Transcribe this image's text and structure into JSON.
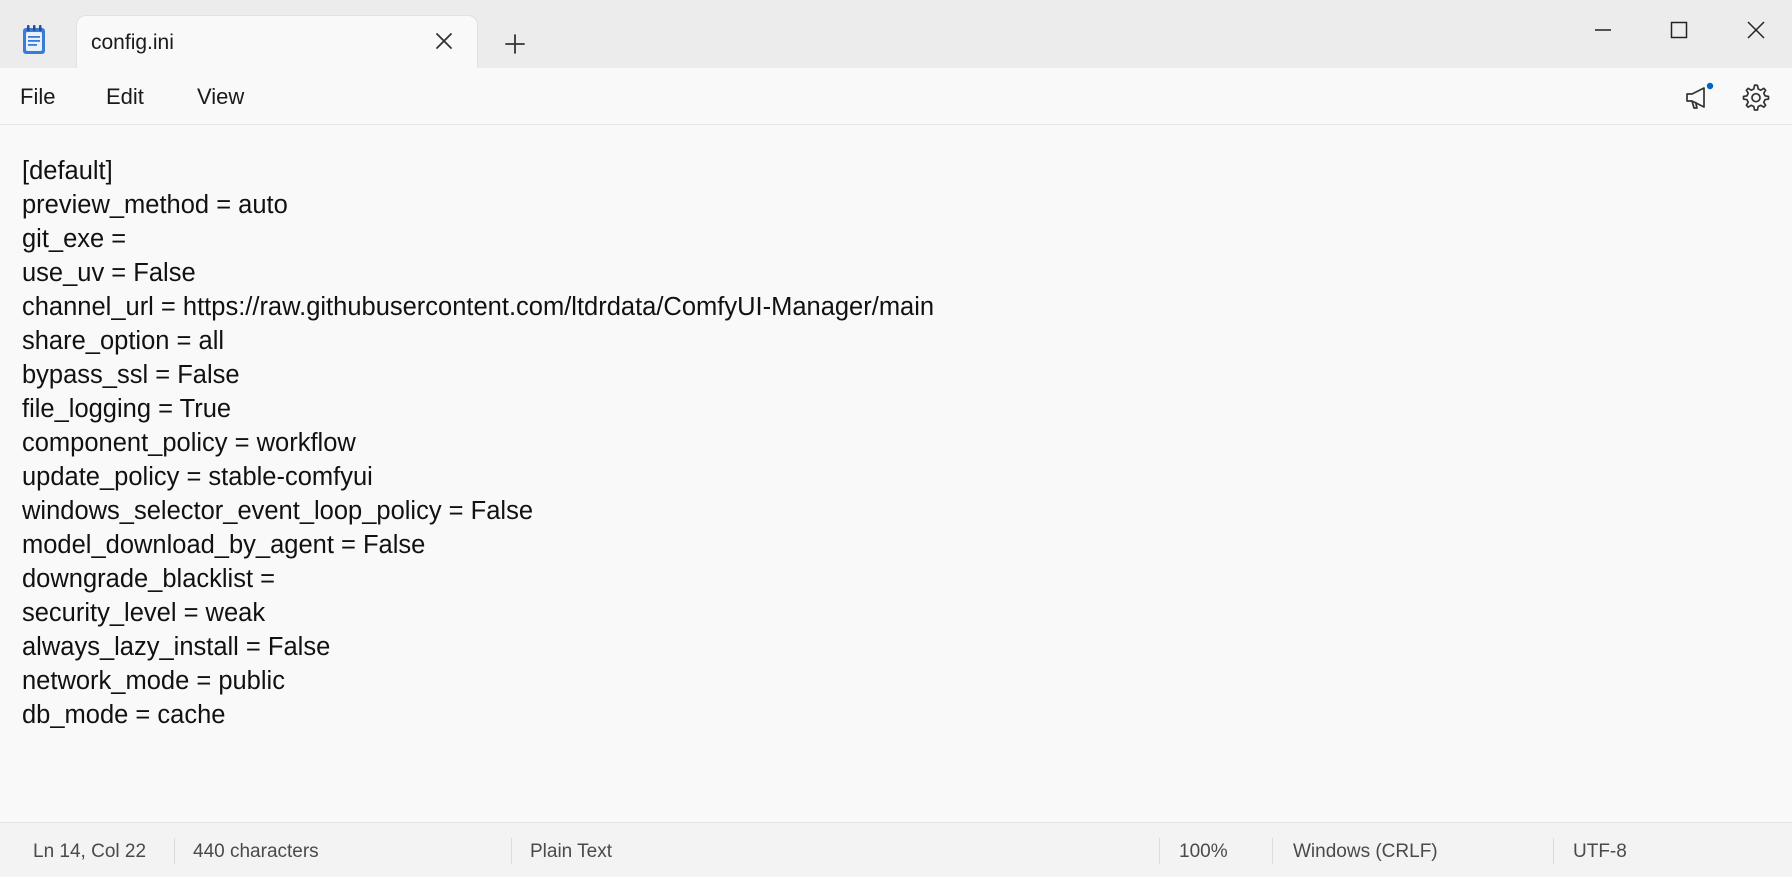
{
  "tab": {
    "title": "config.ini"
  },
  "menu": {
    "file": "File",
    "edit": "Edit",
    "view": "View"
  },
  "editor": {
    "lines": [
      "[default]",
      "preview_method = auto",
      "git_exe =",
      "use_uv = False",
      "channel_url = https://raw.githubusercontent.com/ltdrdata/ComfyUI-Manager/main",
      "share_option = all",
      "bypass_ssl = False",
      "file_logging = True",
      "component_policy = workflow",
      "update_policy = stable-comfyui",
      "windows_selector_event_loop_policy = False",
      "model_download_by_agent = False",
      "downgrade_blacklist =",
      "security_level = weak",
      "always_lazy_install = False",
      "network_mode = public",
      "db_mode = cache"
    ]
  },
  "status": {
    "position": "Ln 14, Col 22",
    "characters": "440 characters",
    "file_type": "Plain Text",
    "zoom": "100%",
    "line_ending": "Windows (CRLF)",
    "encoding": "UTF-8"
  },
  "colors": {
    "accent": "#0067c0",
    "notification_dot": "#0067c0",
    "notepad_icon": "#2f6db5"
  },
  "icons": {
    "app": "notepad-icon",
    "tab_close": "close-icon",
    "new_tab": "plus-icon",
    "minimize": "minimize-icon",
    "maximize": "maximize-icon",
    "close": "close-icon",
    "whats_new": "megaphone-icon",
    "settings": "gear-icon"
  }
}
